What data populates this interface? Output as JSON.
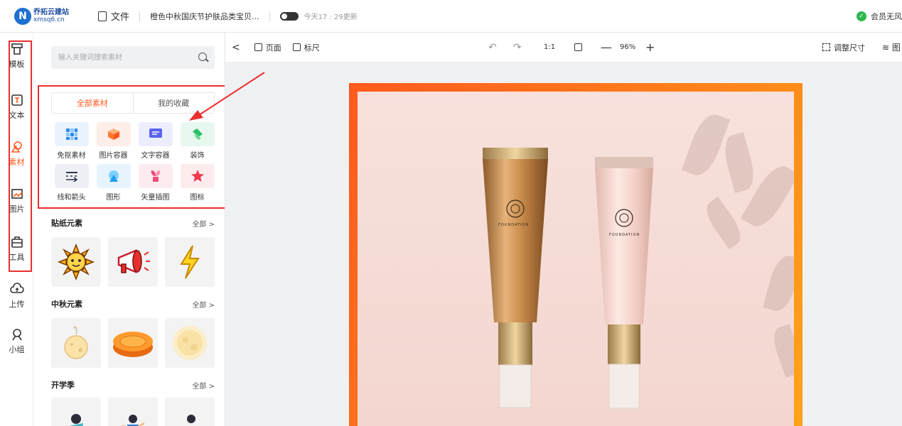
{
  "header": {
    "logo_mark": "N",
    "logo_name": "乔拓云建站",
    "logo_url": "xmsq6.cn",
    "file_label": "文件",
    "doc_title": "橙色中秋国庆节护肤品类宝贝...",
    "save_status": "今天17 : 29更新",
    "member_label": "会员无风",
    "member_check": "✓"
  },
  "leftnav": {
    "items": [
      {
        "label": "模板",
        "icon": "template-icon"
      },
      {
        "label": "文本",
        "icon": "text-icon"
      },
      {
        "label": "素材",
        "icon": "material-icon"
      },
      {
        "label": "图片",
        "icon": "image-icon"
      },
      {
        "label": "工具",
        "icon": "toolbox-icon"
      },
      {
        "label": "上传",
        "icon": "upload-cloud-icon"
      },
      {
        "label": "小组",
        "icon": "group-icon"
      }
    ],
    "active_index": 2
  },
  "panel": {
    "search_placeholder": "输入关键词搜索素材",
    "tabs": [
      "全部素材",
      "我的收藏"
    ],
    "categories": [
      {
        "label": "免抠素材",
        "icon": "mosaic-icon",
        "bg": "#eaf3fd",
        "color": "#2a8cf0"
      },
      {
        "label": "图片容器",
        "icon": "cube-icon",
        "bg": "#fdeee8",
        "color": "#ff7a2e"
      },
      {
        "label": "文字容器",
        "icon": "textbox-icon",
        "bg": "#eceefd",
        "color": "#5b63f0"
      },
      {
        "label": "装饰",
        "icon": "decoration-icon",
        "bg": "#e9f8ef",
        "color": "#28c06a"
      },
      {
        "label": "线和箭头",
        "icon": "line-arrow-icon",
        "bg": "#eef0f5",
        "color": "#2e3850"
      },
      {
        "label": "图形",
        "icon": "shape-icon",
        "bg": "#e8f4fd",
        "color": "#1ea0f0"
      },
      {
        "label": "矢量插图",
        "icon": "plant-icon",
        "bg": "#fdecef",
        "color": "#f04b7a"
      },
      {
        "label": "图标",
        "icon": "star-icon",
        "bg": "#fdecee",
        "color": "#f03a50"
      }
    ],
    "sections": [
      {
        "title": "贴纸元素",
        "all": "全部 >"
      },
      {
        "title": "中秋元素",
        "all": "全部 >"
      },
      {
        "title": "开学季",
        "all": "全部 >"
      }
    ]
  },
  "canvas_toolbar": {
    "collapse": "<",
    "page_label": "页面",
    "ruler_label": "标尺",
    "undo": "↶",
    "redo": "↷",
    "ratio": "1:1",
    "minus": "—",
    "zoom": "96%",
    "plus": "+",
    "resize_label": "调整尺寸",
    "layers_label": "图"
  },
  "canvas": {
    "tube_text_1": "FOUNDATION",
    "tube_text_2": "FOUNDATION"
  },
  "colors": {
    "accent": "#ff5a1f",
    "annotation": "#e8302f"
  }
}
